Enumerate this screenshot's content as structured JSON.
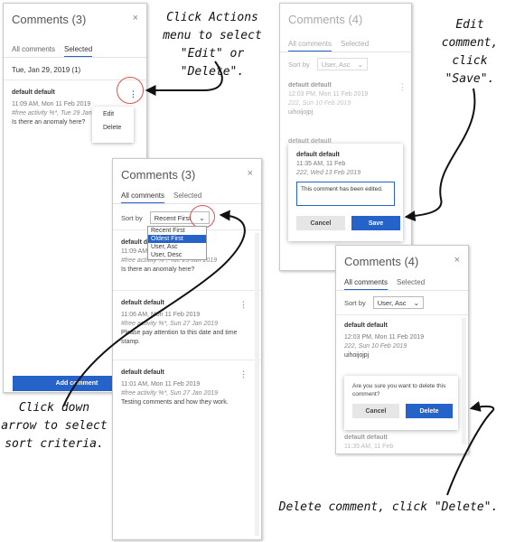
{
  "panel_actions": {
    "title": "Comments (3)",
    "close": "×",
    "tabs": [
      "All comments",
      "Selected"
    ],
    "date_group": "Tue, Jan 29, 2019 (1)",
    "comment": {
      "author": "default default",
      "time": "11:09 AM, Mon 11 Feb 2019",
      "activity": "#free activity %*, Tue 29 Jan",
      "text": "Is there an anomaly here?"
    },
    "menu": [
      "Edit",
      "Delete"
    ],
    "add_comment": "Add comment"
  },
  "panel_sort": {
    "title": "Comments (3)",
    "close": "×",
    "tabs": [
      "All comments",
      "Selected"
    ],
    "sort_label": "Sort by",
    "sort_value": "Recent First",
    "sort_options": [
      "Recent First",
      "Oldest First",
      "User, Asc",
      "User, Desc"
    ],
    "comments": [
      {
        "author": "default default",
        "time": "11:09 AM",
        "activity": "#free activity %*, Tue 29 Jan 2019",
        "text": "Is there an anomaly here?"
      },
      {
        "author": "default default",
        "time": "11:06 AM, Mon 11 Feb 2019",
        "activity": "#free activity %*, Sun 27 Jan 2019",
        "text": "Please pay attention to this date and time stamp."
      },
      {
        "author": "default default",
        "time": "11:01 AM, Mon 11 Feb 2019",
        "activity": "#free activity %*, Sun 27 Jan 2019",
        "text": "Testing comments and how they work."
      }
    ]
  },
  "panel_edit": {
    "title": "Comments (4)",
    "tabs": [
      "All comments",
      "Selected"
    ],
    "sort_label": "Sort by",
    "sort_value": "User, Asc",
    "comment1": {
      "author": "default default",
      "time": "12:03 PM, Mon 11 Feb 2019",
      "activity": "222, Sun 10 Feb 2019",
      "text": "uihoijojpj"
    },
    "peek_author": "default default",
    "edit": {
      "author": "default default",
      "time": "11:35 AM, 11 Feb",
      "activity": "222, Wed 13 Feb 2019",
      "value": "This comment has been edited."
    },
    "cancel": "Cancel",
    "save": "Save"
  },
  "panel_delete": {
    "title": "Comments (4)",
    "close": "×",
    "tabs": [
      "All comments",
      "Selected"
    ],
    "sort_label": "Sort by",
    "sort_value": "User, Asc",
    "comment": {
      "author": "default default",
      "time": "12:03 PM, Mon 11 Feb 2019",
      "activity": "222, Sun 10 Feb 2019",
      "text": "uihoijojpj"
    },
    "confirm_text": "Are you sure you want to delete this comment?",
    "cancel": "Cancel",
    "delete": "Delete",
    "peek_author": "default default",
    "peek_time": "11:35 AM, 11 Feb"
  },
  "annotations": {
    "actions": "Click Actions menu to select \"Edit\" or \"Delete\".",
    "edit": "Edit comment, click \"Save\".",
    "sort": "Click down arrow to select sort criteria.",
    "delete": "Delete comment, click \"Delete\"."
  },
  "colors": {
    "accent": "#2563c9",
    "callout": "#d9534f"
  }
}
